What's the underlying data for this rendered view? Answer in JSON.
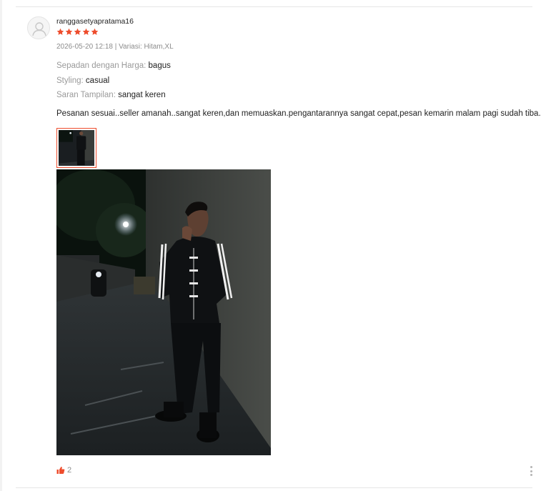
{
  "review": {
    "username": "ranggasetyapratama16",
    "rating": 5,
    "date": "2026-05-20 12:18",
    "separator": " | ",
    "variation_label": "Variasi:",
    "variation_value": "Hitam,XL",
    "attributes": [
      {
        "label": "Sepadan dengan Harga:",
        "value": "bagus"
      },
      {
        "label": "Styling:",
        "value": "casual"
      },
      {
        "label": "Saran Tampilan:",
        "value": "sangat keren"
      }
    ],
    "comment": "Pesanan sesuai..seller amanah..sangat keren,dan memuaskan.pengantarannya sangat cepat,pesan kemarin malam pagi sudah tiba.",
    "likes": "2"
  },
  "colors": {
    "accent": "#ee4d2d",
    "muted_text": "#8c8c8c",
    "divider": "#e6e6e6"
  },
  "icons": {
    "avatar": "user-placeholder-icon",
    "star": "star-icon",
    "like": "thumbs-up-icon",
    "more": "more-vertical-icon"
  }
}
